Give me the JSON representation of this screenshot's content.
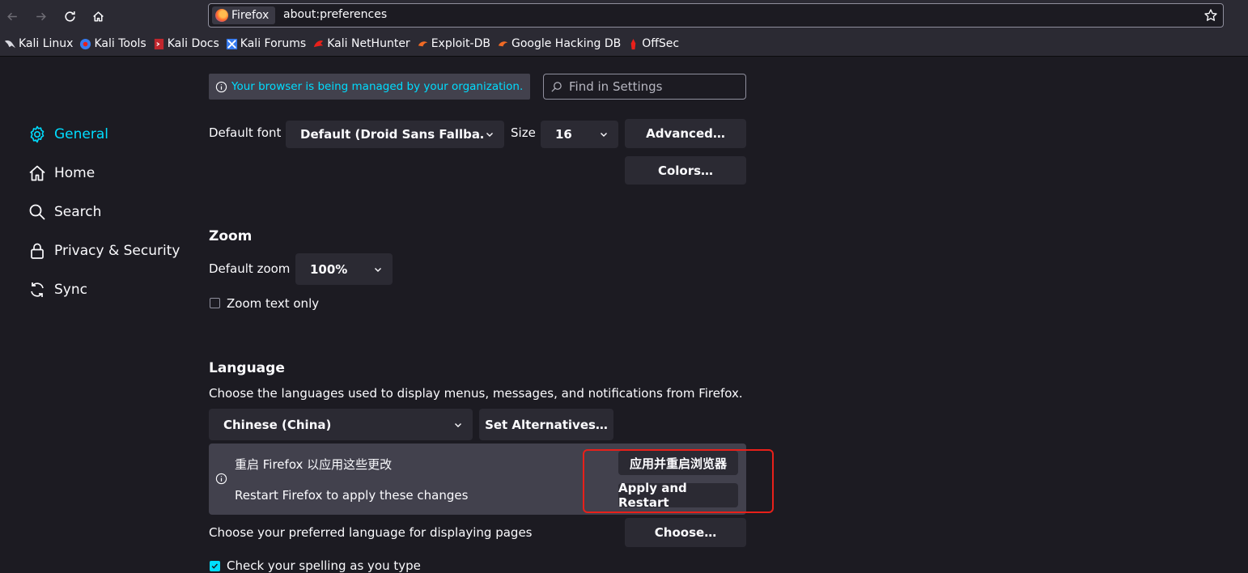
{
  "toolbar": {
    "identity_label": "Firefox",
    "url": "about:preferences",
    "icons": [
      "back-icon",
      "forward-icon",
      "reload-icon",
      "home-icon",
      "bookmark-star-icon"
    ]
  },
  "bookmarks": [
    {
      "label": "Kali Linux",
      "icon": "kali-dragon-icon"
    },
    {
      "label": "Kali Tools",
      "icon": "kali-tools-icon"
    },
    {
      "label": "Kali Docs",
      "icon": "kali-docs-icon"
    },
    {
      "label": "Kali Forums",
      "icon": "kali-forums-icon"
    },
    {
      "label": "Kali NetHunter",
      "icon": "kali-nethunter-icon"
    },
    {
      "label": "Exploit-DB",
      "icon": "exploit-db-icon"
    },
    {
      "label": "Google Hacking DB",
      "icon": "ghdb-icon"
    },
    {
      "label": "OffSec",
      "icon": "offsec-icon"
    }
  ],
  "sidebar": {
    "items": [
      {
        "label": "General",
        "icon": "gear-icon",
        "active": true
      },
      {
        "label": "Home",
        "icon": "home-icon"
      },
      {
        "label": "Search",
        "icon": "search-icon"
      },
      {
        "label": "Privacy & Security",
        "icon": "lock-icon"
      },
      {
        "label": "Sync",
        "icon": "sync-icon"
      }
    ]
  },
  "managed_notice": "Your browser is being managed by your organization.",
  "find": {
    "placeholder": "Find in Settings"
  },
  "fonts": {
    "default_font_label": "Default font",
    "default_font_value": "Default (Droid Sans Fallba…",
    "size_label": "Size",
    "size_value": "16",
    "advanced_button": "Advanced…",
    "colors_button": "Colors…"
  },
  "zoom": {
    "heading": "Zoom",
    "default_zoom_label": "Default zoom",
    "default_zoom_value": "100%",
    "zoom_text_only_label": "Zoom text only",
    "zoom_text_only_checked": false
  },
  "language": {
    "heading": "Language",
    "description": "Choose the languages used to display menus, messages, and notifications from Firefox.",
    "selected": "Chinese (China)",
    "set_alternatives_button": "Set Alternatives…",
    "restart_notice_zh": "重启 Firefox 以应用这些更改",
    "restart_notice_en": "Restart Firefox to apply these changes",
    "apply_button_zh": "应用并重启浏览器",
    "apply_button_en": "Apply and Restart",
    "pages_label": "Choose your preferred language for displaying pages",
    "choose_button": "Choose…",
    "spellcheck_label": "Check your spelling as you type",
    "spellcheck_checked": true
  },
  "colors": {
    "accent": "#00ddff",
    "highlight": "#e8201a",
    "background": "#1c1b22",
    "surface": "#2b2a33"
  }
}
